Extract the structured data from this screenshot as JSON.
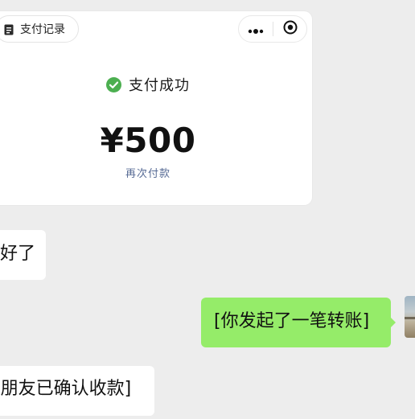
{
  "payment_card": {
    "records_label": "支付记录",
    "status_text": "支付成功",
    "amount": "¥500",
    "repay_label": "再次付款",
    "icons": {
      "records": "document-icon",
      "status": "check-circle-icon",
      "more": "more-dots-icon",
      "close": "target-close-icon"
    },
    "colors": {
      "success": "#4caf50",
      "link": "#576b95"
    }
  },
  "chat": {
    "messages": [
      {
        "side": "left",
        "text": "好了"
      },
      {
        "side": "right",
        "text": "[你发起了一笔转账]"
      },
      {
        "side": "left",
        "text": "[朋友已确认收款]"
      }
    ],
    "colors": {
      "background": "#ededed",
      "incoming_bubble": "#ffffff",
      "outgoing_bubble": "#95ec69"
    }
  }
}
